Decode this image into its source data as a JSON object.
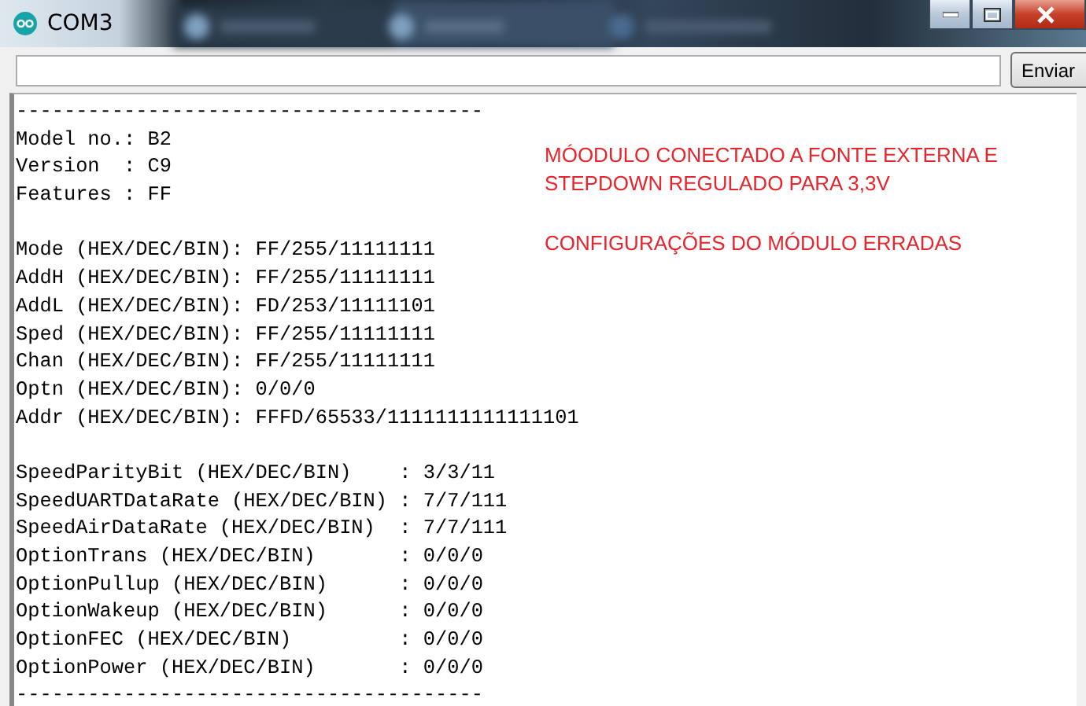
{
  "window": {
    "title": "COM3"
  },
  "send_button": {
    "label": "Enviar"
  },
  "output_blocks": [
    [
      "---------------------------------------",
      "Model no.: B2",
      "Version  : C9",
      "Features : FF"
    ],
    [
      "Mode (HEX/DEC/BIN): FF/255/11111111",
      "AddH (HEX/DEC/BIN): FF/255/11111111",
      "AddL (HEX/DEC/BIN): FD/253/11111101",
      "Sped (HEX/DEC/BIN): FF/255/11111111",
      "Chan (HEX/DEC/BIN): FF/255/11111111",
      "Optn (HEX/DEC/BIN): 0/0/0",
      "Addr (HEX/DEC/BIN): FFFD/65533/1111111111111101"
    ],
    [
      "SpeedParityBit (HEX/DEC/BIN)    : 3/3/11",
      "SpeedUARTDataRate (HEX/DEC/BIN) : 7/7/111",
      "SpeedAirDataRate (HEX/DEC/BIN)  : 7/7/111",
      "OptionTrans (HEX/DEC/BIN)       : 0/0/0",
      "OptionPullup (HEX/DEC/BIN)      : 0/0/0",
      "OptionWakeup (HEX/DEC/BIN)      : 0/0/0",
      "OptionFEC (HEX/DEC/BIN)         : 0/0/0",
      "OptionPower (HEX/DEC/BIN)       : 0/0/0",
      "---------------------------------------"
    ]
  ],
  "annotations": [
    {
      "text": "MÓODULO CONECTADO A FONTE EXTERNA E\nSTEPDOWN REGULADO PARA 3,3V"
    },
    {
      "text": "CONFIGURAÇÕES DO MÓDULO ERRADAS"
    }
  ]
}
